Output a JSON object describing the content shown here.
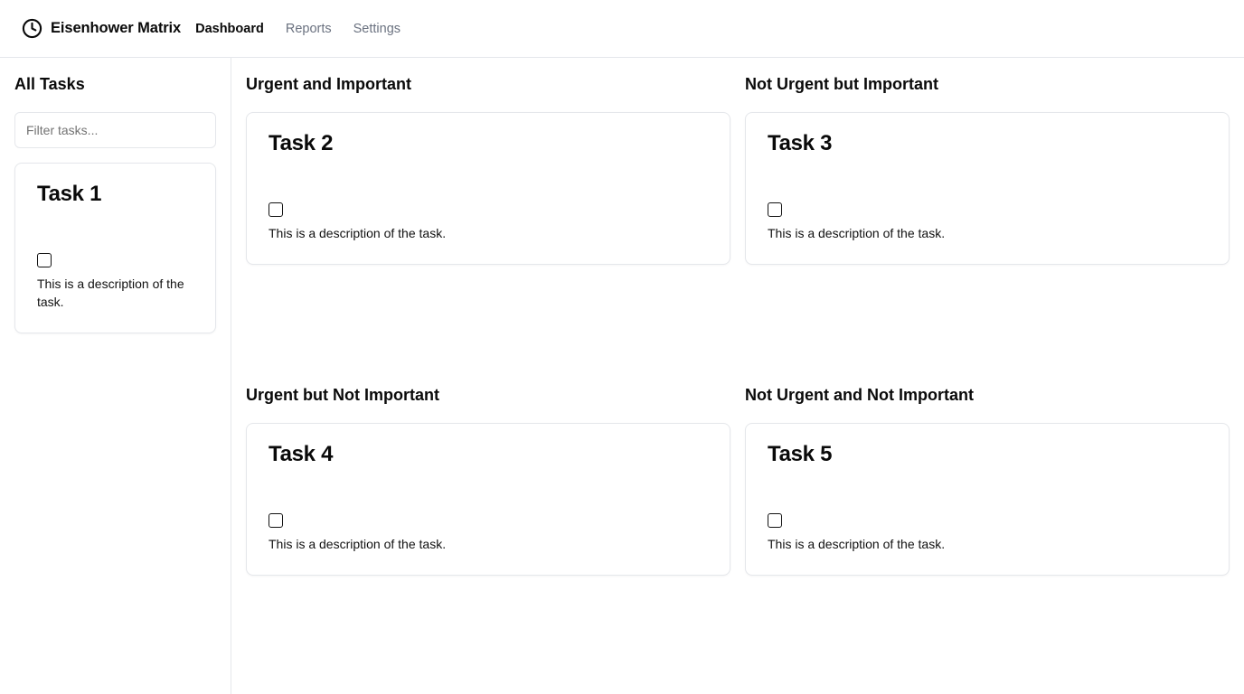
{
  "app": {
    "title": "Eisenhower Matrix",
    "icon": "clock-icon"
  },
  "nav": {
    "items": [
      {
        "label": "Dashboard",
        "active": true
      },
      {
        "label": "Reports",
        "active": false
      },
      {
        "label": "Settings",
        "active": false
      }
    ]
  },
  "sidebar": {
    "title": "All Tasks",
    "filter_placeholder": "Filter tasks...",
    "filter_value": "",
    "tasks": [
      {
        "title": "Task 1",
        "description": "This is a description of the task.",
        "checked": false
      }
    ]
  },
  "quadrants": [
    {
      "title": "Urgent and Important",
      "tasks": [
        {
          "title": "Task 2",
          "description": "This is a description of the task.",
          "checked": false
        }
      ]
    },
    {
      "title": "Not Urgent but Important",
      "tasks": [
        {
          "title": "Task 3",
          "description": "This is a description of the task.",
          "checked": false
        }
      ]
    },
    {
      "title": "Urgent but Not Important",
      "tasks": [
        {
          "title": "Task 4",
          "description": "This is a description of the task.",
          "checked": false
        }
      ]
    },
    {
      "title": "Not Urgent and Not Important",
      "tasks": [
        {
          "title": "Task 5",
          "description": "This is a description of the task.",
          "checked": false
        }
      ]
    }
  ],
  "colors": {
    "border": "#e5e7eb",
    "text": "#0a0a0a",
    "muted": "#6b7280"
  }
}
